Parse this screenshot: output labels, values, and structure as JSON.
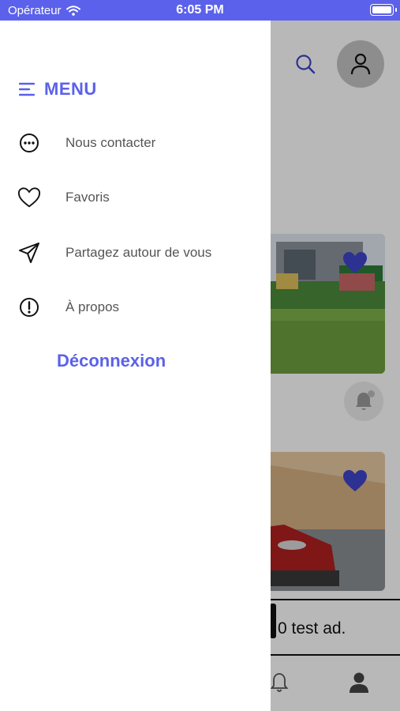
{
  "status_bar": {
    "carrier": "Opérateur",
    "time": "6:05 PM"
  },
  "drawer": {
    "title": "MENU",
    "items": [
      {
        "label": "Nous contacter",
        "icon": "chat-bubble-icon"
      },
      {
        "label": "Favoris",
        "icon": "heart-icon"
      },
      {
        "label": "Partagez autour de vous",
        "icon": "send-icon"
      },
      {
        "label": "À propos",
        "icon": "info-icon"
      }
    ],
    "logout_label": "Déconnexion"
  },
  "background": {
    "ad_text": "0 test ad."
  },
  "colors": {
    "accent": "#5b61ea",
    "favorite": "#3f44c9",
    "overlay": "#000000"
  }
}
